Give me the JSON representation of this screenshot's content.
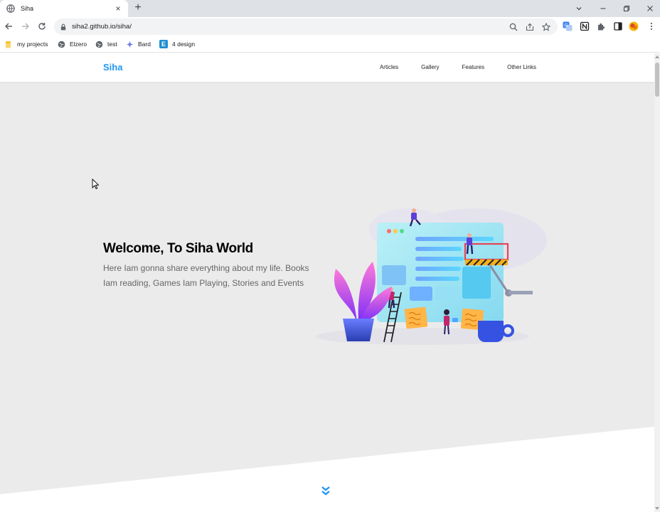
{
  "browser": {
    "tab": {
      "title": "Siha",
      "favicon": "globe-icon",
      "close": "×"
    },
    "new_tab": "+",
    "address": {
      "url": "siha2.github.io/siha/"
    },
    "bookmarks": [
      {
        "label": "my projects",
        "icon": "folder-icon"
      },
      {
        "label": "Elzero",
        "icon": "globe-icon"
      },
      {
        "label": "test",
        "icon": "globe-icon"
      },
      {
        "label": "Bard",
        "icon": "sparkle-icon"
      },
      {
        "label": "4 design",
        "icon": "e-logo-icon",
        "badge": "E"
      }
    ],
    "colors": {
      "tabstrip": "#dee1e6",
      "omnibox": "#f1f3f4"
    }
  },
  "site": {
    "logo": "Siha",
    "nav": [
      "Articles",
      "Gallery",
      "Features",
      "Other Links"
    ],
    "hero": {
      "title": "Welcome, To Siha World",
      "description": "Here Iam gonna share everything about my life. Books Iam reading, Games Iam Playing, Stories and Events"
    },
    "colors": {
      "brand": "#2196f3",
      "hero_bg": "#ebebec",
      "text_muted": "#666666"
    }
  }
}
